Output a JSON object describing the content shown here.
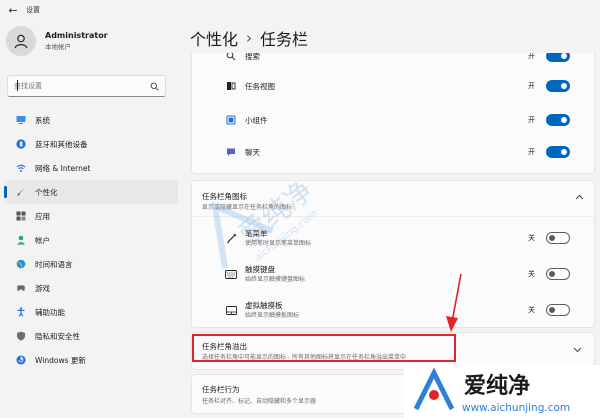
{
  "app": {
    "title": "设置",
    "back_glyph": "←"
  },
  "profile": {
    "name": "Administrator",
    "account_type": "本地帐户"
  },
  "search": {
    "placeholder": "查找设置"
  },
  "nav": [
    {
      "label": "系统",
      "icon": "monitor-icon",
      "active": false
    },
    {
      "label": "蓝牙和其他设备",
      "icon": "bluetooth-icon",
      "active": false
    },
    {
      "label": "网络 & Internet",
      "icon": "wifi-icon",
      "active": false
    },
    {
      "label": "个性化",
      "icon": "brush-icon",
      "active": true
    },
    {
      "label": "应用",
      "icon": "apps-icon",
      "active": false
    },
    {
      "label": "帐户",
      "icon": "person-icon",
      "active": false
    },
    {
      "label": "时间和语言",
      "icon": "globe-icon",
      "active": false
    },
    {
      "label": "游戏",
      "icon": "gamepad-icon",
      "active": false
    },
    {
      "label": "辅助功能",
      "icon": "accessibility-icon",
      "active": false
    },
    {
      "label": "隐私和安全性",
      "icon": "shield-icon",
      "active": false
    },
    {
      "label": "Windows 更新",
      "icon": "update-icon",
      "active": false
    }
  ],
  "breadcrumb": {
    "parent": "个性化",
    "separator": "›",
    "current": "任务栏"
  },
  "taskbar_items": [
    {
      "label": "搜索",
      "state_label": "开",
      "on": true,
      "icon": "search-icon"
    },
    {
      "label": "任务视图",
      "state_label": "开",
      "on": true,
      "icon": "task-view-icon"
    },
    {
      "label": "小组件",
      "state_label": "开",
      "on": true,
      "icon": "widgets-icon"
    },
    {
      "label": "聊天",
      "state_label": "开",
      "on": true,
      "icon": "chat-icon"
    }
  ],
  "corner_icons": {
    "title": "任务栏角图标",
    "subtitle": "显示或隐藏显示在任务栏角的图标",
    "items": [
      {
        "title": "笔菜单",
        "subtitle": "使用笔时显示笔菜单图标",
        "state_label": "关",
        "on": false,
        "icon": "pen-icon"
      },
      {
        "title": "触摸键盘",
        "subtitle": "始终显示触摸键盘图标",
        "state_label": "关",
        "on": false,
        "icon": "keyboard-icon"
      },
      {
        "title": "虚拟触摸板",
        "subtitle": "始终显示触摸板图标",
        "state_label": "关",
        "on": false,
        "icon": "touchpad-icon"
      }
    ]
  },
  "overflow": {
    "title": "任务栏角溢出",
    "subtitle": "选择任务栏角中可能显示的图标 - 所有其他图标将显示在任务栏角溢出菜单中"
  },
  "behaviors": {
    "title": "任务栏行为",
    "subtitle": "任务栏对齐、标记、自动隐藏和多个显示器"
  },
  "watermark": {
    "text": "爱纯净",
    "url": "aichunjing.com"
  },
  "brand": {
    "name": "爱纯净",
    "url": "www.aichunjing.com"
  },
  "colors": {
    "accent": "#0067c0",
    "highlight": "#e0242a"
  }
}
